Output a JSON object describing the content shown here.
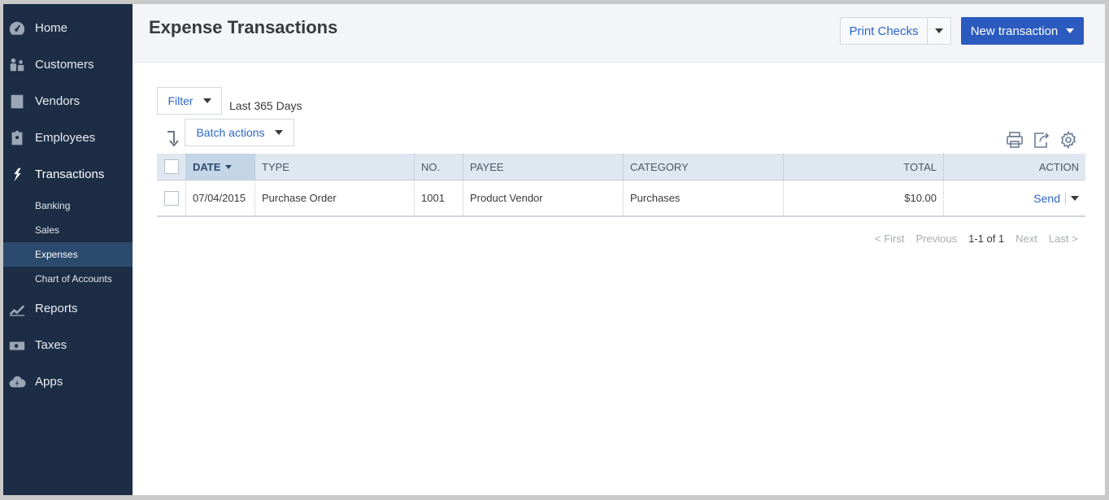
{
  "sidebar": {
    "items": [
      {
        "label": "Home",
        "icon": "dashboard-icon"
      },
      {
        "label": "Customers",
        "icon": "customers-icon"
      },
      {
        "label": "Vendors",
        "icon": "vendors-icon"
      },
      {
        "label": "Employees",
        "icon": "employees-icon"
      },
      {
        "label": "Transactions",
        "icon": "transactions-icon"
      },
      {
        "label": "Reports",
        "icon": "reports-icon"
      },
      {
        "label": "Taxes",
        "icon": "taxes-icon"
      },
      {
        "label": "Apps",
        "icon": "apps-icon"
      }
    ],
    "subitems": [
      {
        "label": "Banking"
      },
      {
        "label": "Sales"
      },
      {
        "label": "Expenses",
        "active": true
      },
      {
        "label": "Chart of Accounts"
      }
    ]
  },
  "header": {
    "title": "Expense Transactions",
    "print_checks": "Print Checks",
    "new_transaction": "New transaction"
  },
  "filter": {
    "button": "Filter",
    "range": "Last 365 Days",
    "batch_actions": "Batch actions"
  },
  "table": {
    "columns": [
      "DATE",
      "TYPE",
      "NO.",
      "PAYEE",
      "CATEGORY",
      "TOTAL",
      "ACTION"
    ],
    "rows": [
      {
        "date": "07/04/2015",
        "type": "Purchase Order",
        "no": "1001",
        "payee": "Product Vendor",
        "category": "Purchases",
        "total": "$10.00",
        "action": "Send"
      }
    ]
  },
  "pager": {
    "first": "< First",
    "previous": "Previous",
    "range": "1-1 of 1",
    "next": "Next",
    "last": "Last >"
  },
  "colors": {
    "sidebar_bg": "#1c2d45",
    "sidebar_active": "#2b4a6d",
    "primary": "#2c5bbf",
    "link": "#2c66c7"
  }
}
